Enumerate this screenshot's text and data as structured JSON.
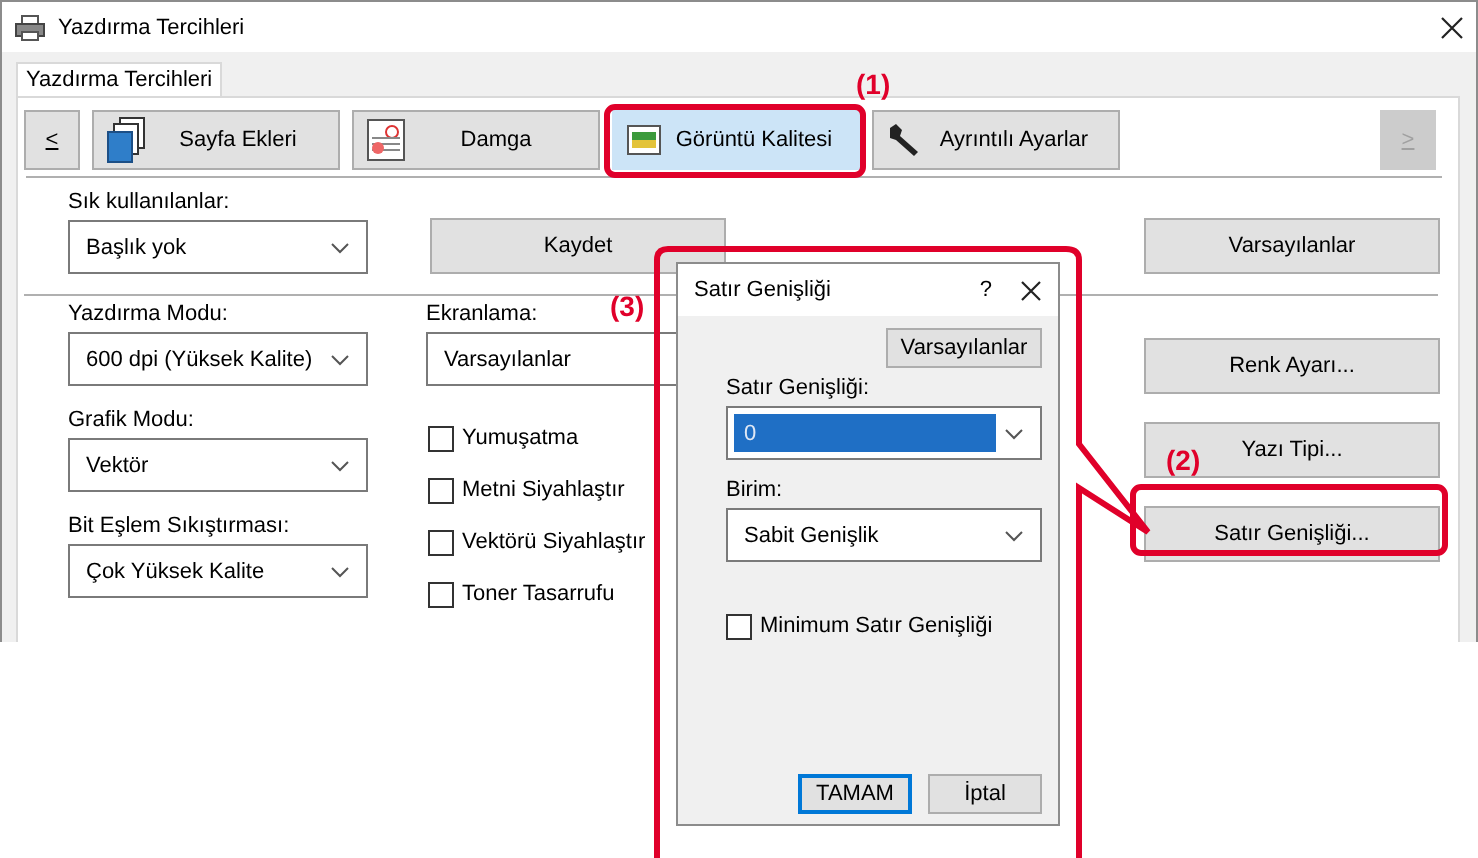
{
  "window": {
    "title": "Yazdırma Tercihleri"
  },
  "tabs": [
    {
      "label": "Yazdırma Tercihleri",
      "selected": true
    }
  ],
  "toolbar": {
    "prev": {
      "label": "<",
      "disabled": false
    },
    "items": [
      {
        "label": "Sayfa Ekleri",
        "selected": false
      },
      {
        "label": "Damga",
        "selected": false
      },
      {
        "label": "Görüntü Kalitesi",
        "selected": true
      },
      {
        "label": "Ayrıntılı Ayarlar",
        "selected": false
      }
    ],
    "next": {
      "label": ">",
      "disabled": true
    }
  },
  "favorites": {
    "label": "Sık kullanılanlar:",
    "value": "Başlık yok"
  },
  "save_button": "Kaydet",
  "defaults_button": "Varsayılanlar",
  "left_fields": [
    {
      "label": "Yazdırma Modu:",
      "value": "600 dpi (Yüksek Kalite)"
    },
    {
      "label": "Grafik Modu:",
      "value": "Vektör"
    },
    {
      "label": "Bit Eşlem Sıkıştırması:",
      "value": "Çok Yüksek Kalite"
    }
  ],
  "screening": {
    "label": "Ekranlama:",
    "value": "Varsayılanlar"
  },
  "checkboxes": [
    {
      "label": "Yumuşatma",
      "checked": false
    },
    {
      "label": "Metni Siyahlaştır",
      "checked": false
    },
    {
      "label": "Vektörü Siyahlaştır",
      "checked": false
    },
    {
      "label": "Toner Tasarrufu",
      "checked": false
    }
  ],
  "side_buttons": [
    "Renk Ayarı...",
    "Yazı Tipi...",
    "Satır Genişliği..."
  ],
  "dialog": {
    "title": "Satır Genişliği",
    "help": "?",
    "defaults_button": "Varsayılanlar",
    "width_field": {
      "label": "Satır Genişliği:",
      "value": "0",
      "focused": true
    },
    "unit_field": {
      "label": "Birim:",
      "value": "Sabit Genişlik"
    },
    "minimum": {
      "label": "Minimum Satır Genişliği",
      "checked": false
    },
    "buttons": [
      "TAMAM",
      "İptal"
    ]
  },
  "callouts": [
    {
      "label": "(1)"
    },
    {
      "label": "(2)"
    },
    {
      "label": "(3)"
    }
  ]
}
